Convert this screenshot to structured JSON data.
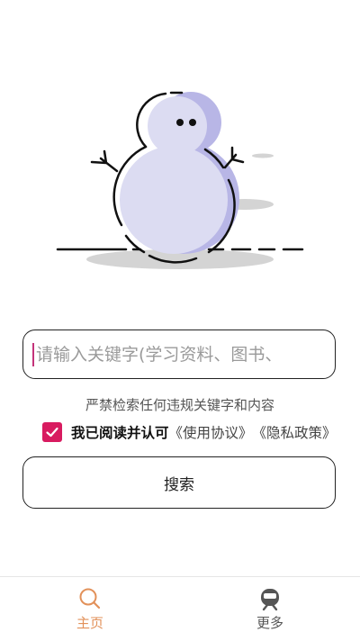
{
  "search": {
    "placeholder": "请输入关键字(学习资料、图书、",
    "value": ""
  },
  "notice": "严禁检索任何违规关键字和内容",
  "agreement": {
    "checked": true,
    "text": "我已阅读并认可",
    "user_agreement": "《使用协议》",
    "privacy_policy": "《隐私政策》"
  },
  "search_button": "搜索",
  "tabbar": {
    "tabs": [
      {
        "label": "主页",
        "icon": "search-icon",
        "active": true
      },
      {
        "label": "更多",
        "icon": "train-icon",
        "active": false
      }
    ]
  },
  "colors": {
    "accent": "#d81b60",
    "tab_active": "#e2915a",
    "illustration_fill": "#dcdcf2",
    "illustration_shadow": "#b8b6e6"
  }
}
